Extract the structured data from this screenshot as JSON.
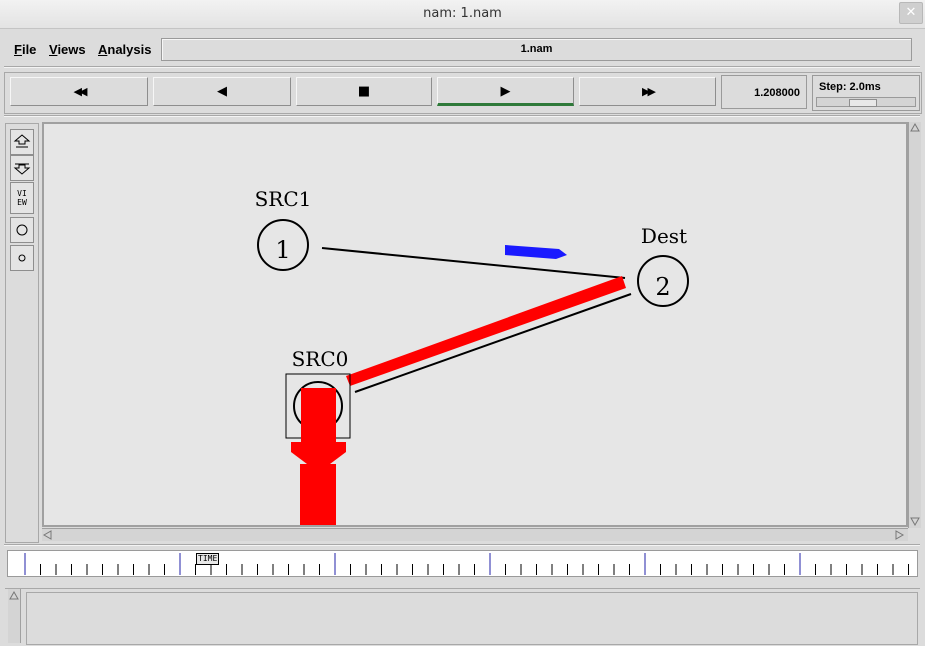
{
  "window": {
    "title": "nam: 1.nam",
    "close_glyph": "✕"
  },
  "menu": {
    "items": [
      {
        "label": "File",
        "accel": "F",
        "rest": "ile"
      },
      {
        "label": "Views",
        "accel": "V",
        "rest": "iews"
      },
      {
        "label": "Analysis",
        "accel": "A",
        "rest": "nalysis"
      }
    ],
    "file_name": "1.nam"
  },
  "controls": {
    "rewind_glyph": "◀◀",
    "back_glyph": "◀",
    "stop_glyph": "■",
    "play_glyph": "▶",
    "fastforward_glyph": "▶▶",
    "active": "play",
    "time": "1.208000",
    "step_label": "Step: 2.0ms",
    "step_slider_position": 0.45
  },
  "toolbar": {
    "zoom_in_icon": "zoom-in-icon",
    "zoom_out_icon": "zoom-out-icon",
    "view_label": "VIEW",
    "node_large_icon": "circle-icon",
    "node_small_icon": "small-circle-icon"
  },
  "network": {
    "nodes": [
      {
        "id": "1",
        "label": "SRC1"
      },
      {
        "id": "2",
        "label": "Dest"
      },
      {
        "id": "0",
        "label": "SRC0"
      }
    ],
    "links": [
      {
        "from": "1",
        "to": "2"
      },
      {
        "from": "0",
        "to": "2"
      }
    ],
    "colors": {
      "packet_blue": "#1a1aff",
      "packet_red": "#ff0000",
      "link": "#000000"
    }
  },
  "timeline": {
    "label": "TIME",
    "marker_position": 0.22
  }
}
